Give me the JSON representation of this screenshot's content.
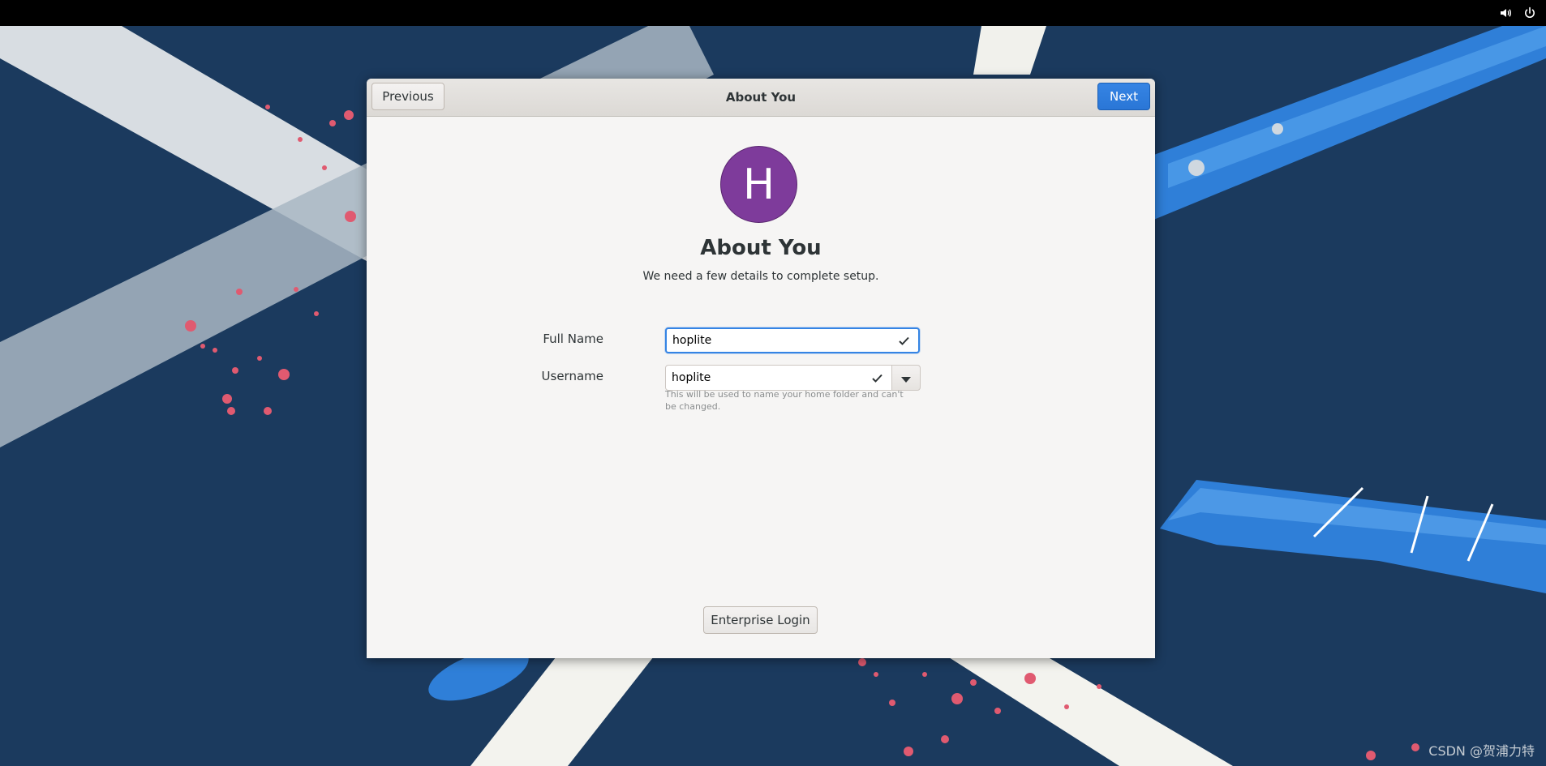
{
  "topbar": {
    "icons": [
      "volume-icon",
      "power-icon"
    ]
  },
  "dialog": {
    "header_title": "About You",
    "previous_label": "Previous",
    "next_label": "Next",
    "avatar_initial": "H",
    "heading": "About You",
    "subtitle": "We need a few details to complete setup.",
    "full_name": {
      "label": "Full Name",
      "value": "hoplite"
    },
    "username": {
      "label": "Username",
      "value": "hoplite",
      "hint": "This will be used to name your home folder and can't be changed."
    },
    "enterprise_login_label": "Enterprise Login"
  },
  "colors": {
    "accent": "#3584e4",
    "avatar": "#7e3b9b",
    "desktop_bg": "#1b3a5e"
  },
  "watermark": "CSDN @贺浦力特"
}
